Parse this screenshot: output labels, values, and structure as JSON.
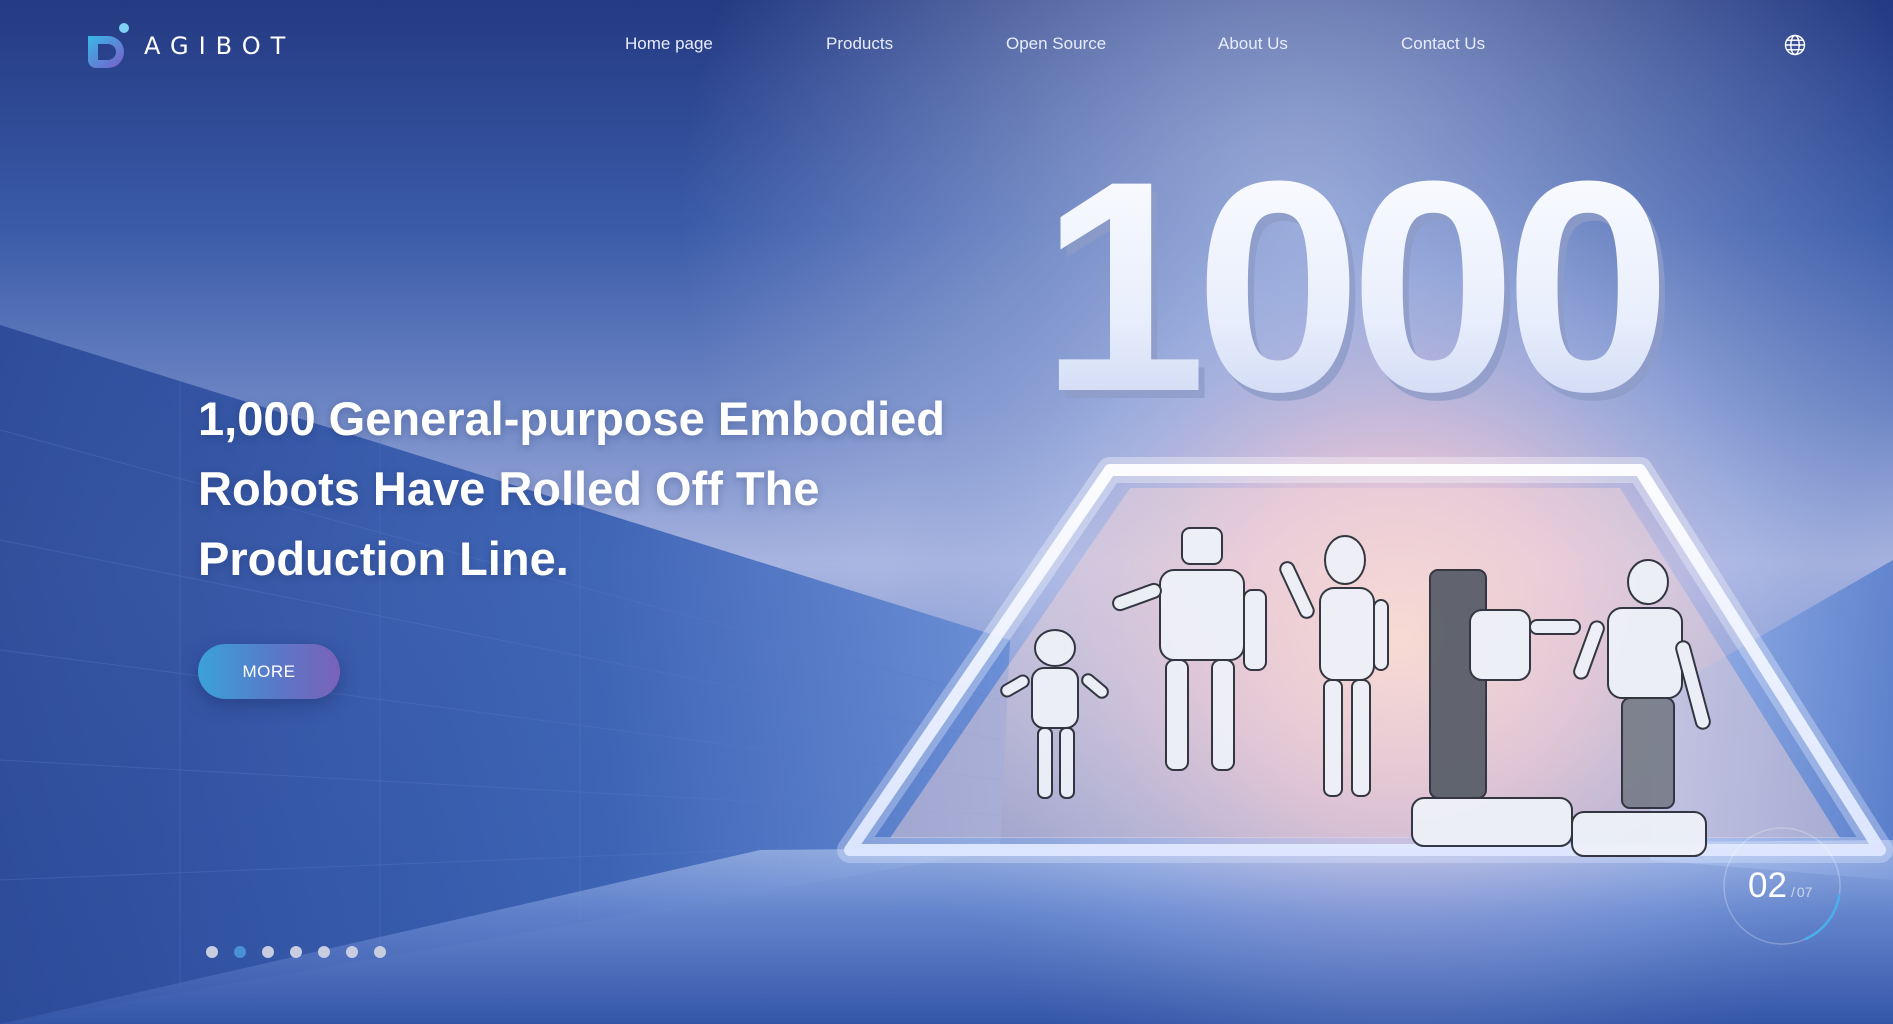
{
  "brand": {
    "name": "AGIBOT"
  },
  "nav": {
    "items": [
      {
        "label": "Home page"
      },
      {
        "label": "Products"
      },
      {
        "label": "Open Source"
      },
      {
        "label": "About Us"
      },
      {
        "label": "Contact Us"
      }
    ],
    "language_icon": "globe-icon"
  },
  "hero": {
    "big_number": "1000",
    "title": "1,000 General-purpose Embodied Robots Have Rolled Off The Production Line.",
    "more_label": "MORE"
  },
  "carousel": {
    "current": "02",
    "separator": "/",
    "total": "07",
    "dots_count": 7,
    "active_index": 1
  },
  "colors": {
    "accent": "#4a90d8",
    "button_start": "#3aa2d8",
    "button_end": "#7a62b8",
    "background_top": "#243a82",
    "background_glow": "#f3c8c8"
  }
}
